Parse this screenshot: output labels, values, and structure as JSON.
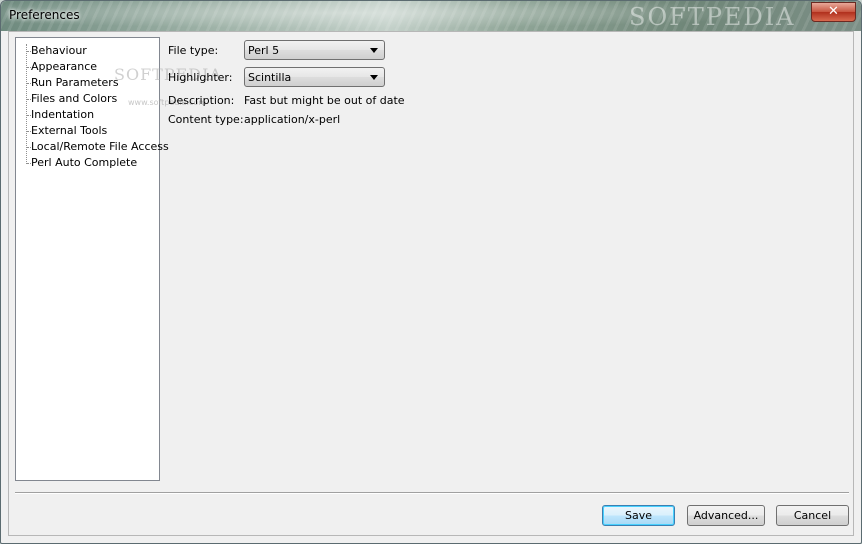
{
  "window": {
    "title": "Preferences",
    "close_glyph": "✕",
    "watermark": "SOFTPEDIA"
  },
  "tree": {
    "items": [
      {
        "label": "Behaviour"
      },
      {
        "label": "Appearance"
      },
      {
        "label": "Run Parameters"
      },
      {
        "label": "Files and Colors"
      },
      {
        "label": "Indentation"
      },
      {
        "label": "External Tools"
      },
      {
        "label": "Local/Remote File Access"
      },
      {
        "label": "Perl Auto Complete"
      }
    ],
    "watermark": "SOFTPEDIA",
    "watermark_url": "www.softpedia.com"
  },
  "form": {
    "file_type_label": "File type:",
    "file_type_value": "Perl 5",
    "highlighter_label": "Highlighter:",
    "highlighter_value": "Scintilla",
    "description_label": "Description:",
    "description_value": "Fast but might be out of date",
    "content_type_label": "Content type:",
    "content_type_value": "application/x-perl"
  },
  "buttons": {
    "save": "Save",
    "advanced": "Advanced...",
    "cancel": "Cancel"
  },
  "colors": {
    "default_button_border": "#3c7fb1",
    "close_button": "#c7543e"
  }
}
